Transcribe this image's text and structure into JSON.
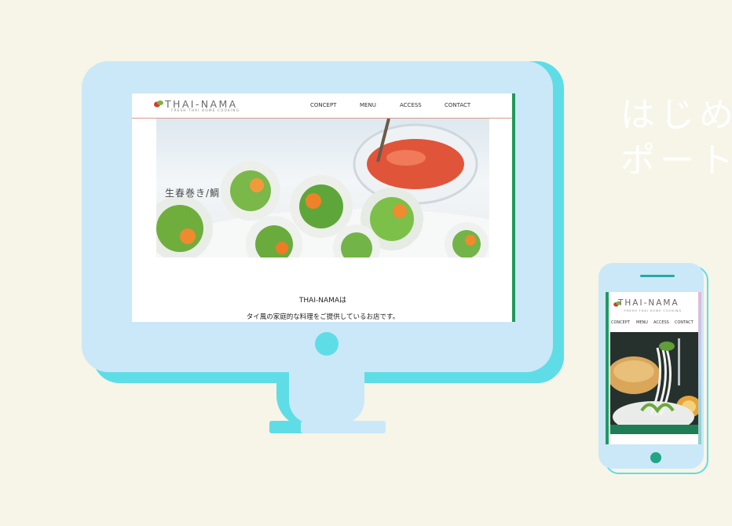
{
  "side_text": {
    "line1": "はじめ",
    "line2": "ポート"
  },
  "desktop_site": {
    "logo_title": "THAI-NAMA",
    "logo_subtitle": "FRESH THAI HOME COOKING",
    "nav": [
      "CONCEPT",
      "MENU",
      "ACCESS",
      "CONTACT"
    ],
    "hero_caption": "生春巻き/鯛",
    "intro_title": "THAI-NAMAは",
    "intro_text": "タイ風の家庭的な料理をご提供しているお店です。"
  },
  "mobile_site": {
    "logo_title": "THAI-NAMA",
    "logo_subtitle": "FRESH THAI HOME COOKING",
    "nav": [
      "CONCEPT",
      "MENU",
      "ACCESS",
      "CONTACT"
    ]
  },
  "colors": {
    "background": "#f6f5e8",
    "device_light": "#cbe8f8",
    "device_accent": "#5fdde6",
    "screen_edge_green": "#1f9a5c"
  }
}
